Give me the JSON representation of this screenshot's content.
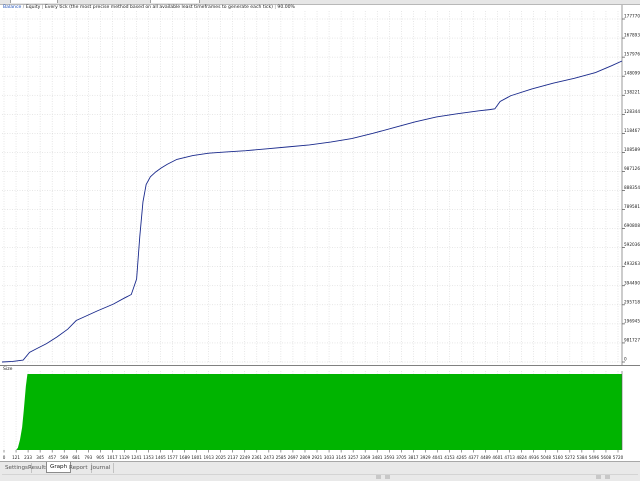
{
  "header": {
    "series": "Balance",
    "series2": "Equity",
    "model": "Every tick (the most precise method based on all available least timeframes to generate each tick)",
    "quality": "90.00%"
  },
  "volume_panel": {
    "label": "Size"
  },
  "tabs": [
    {
      "label": "Settings",
      "active": false
    },
    {
      "label": "Results",
      "active": false
    },
    {
      "label": "Graph",
      "active": true
    },
    {
      "label": "Report",
      "active": false
    },
    {
      "label": "Journal",
      "active": false
    }
  ],
  "colors": {
    "line": "#1a2a8c",
    "volume": "#00b400",
    "grid": "#cfcfcf",
    "background": "#ffffff"
  },
  "chart_data": {
    "type": "line",
    "title": "",
    "y_ticks": [
      "17777083",
      "16789356",
      "15797629",
      "14809903",
      "13822176",
      "12834449",
      "11846722",
      "10858995",
      "9871269",
      "8883542",
      "7895815",
      "6908088",
      "5920361",
      "4932634",
      "3944908",
      "2957181",
      "1969454",
      "981727",
      "0"
    ],
    "x_ticks": [
      "0",
      "121",
      "233",
      "345",
      "457",
      "569",
      "681",
      "793",
      "905",
      "1017",
      "1129",
      "1241",
      "1353",
      "1465",
      "1577",
      "1689",
      "1801",
      "1913",
      "2025",
      "2137",
      "2249",
      "2361",
      "2473",
      "2585",
      "2697",
      "2809",
      "2921",
      "3033",
      "3145",
      "3257",
      "3369",
      "3481",
      "3593",
      "3705",
      "3817",
      "3929",
      "4041",
      "4153",
      "4265",
      "4377",
      "4489",
      "4601",
      "4713",
      "4824",
      "4936",
      "5048",
      "5160",
      "5272",
      "5384",
      "5496",
      "5608",
      "5720"
    ],
    "ylim": [
      0,
      17777083
    ],
    "xlim": [
      0,
      5850
    ],
    "grid": true,
    "series": [
      {
        "x": [
          0,
          100,
          200,
          260,
          330,
          420,
          520,
          620,
          700,
          760,
          900,
          1050,
          1150,
          1220,
          1270,
          1300,
          1330,
          1360,
          1400,
          1450,
          1500,
          1560,
          1650,
          1800,
          1950,
          2100,
          2300,
          2500,
          2700,
          2900,
          3100,
          3300,
          3500,
          3700,
          3900,
          4100,
          4300,
          4500,
          4600,
          4650,
          4700,
          4800,
          5000,
          5200,
          5400,
          5600,
          5750,
          5850
        ],
        "y": [
          0,
          30000,
          100000,
          500000,
          700000,
          950000,
          1300000,
          1700000,
          2150000,
          2300000,
          2650000,
          3000000,
          3300000,
          3500000,
          4300000,
          6500000,
          8300000,
          9200000,
          9600000,
          9850000,
          10050000,
          10250000,
          10500000,
          10700000,
          10820000,
          10880000,
          10950000,
          11050000,
          11150000,
          11250000,
          11400000,
          11580000,
          11850000,
          12150000,
          12450000,
          12700000,
          12870000,
          13020000,
          13080000,
          13120000,
          13500000,
          13800000,
          14150000,
          14450000,
          14700000,
          15000000,
          15350000,
          15600000
        ]
      }
    ],
    "volume": {
      "x": [
        0,
        60,
        120,
        150,
        170,
        190,
        205,
        215,
        225,
        232,
        240,
        5850
      ],
      "y": [
        0,
        2,
        5,
        10,
        20,
        35,
        55,
        70,
        85,
        92,
        100,
        100
      ]
    }
  }
}
